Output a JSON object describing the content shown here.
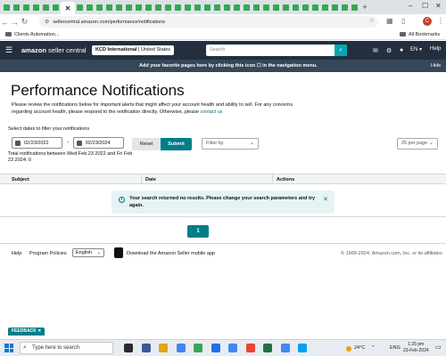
{
  "browser": {
    "url": "sellercentral.amazon.com/performance/notifications",
    "active_tab_glyph": "✕",
    "new_tab": "+",
    "all_bookmarks": "All Bookmarks",
    "bookmark_folder": "Clients Automation...",
    "profile_initial": "C",
    "win_minimize": "–",
    "win_restore": "☐",
    "win_close": "✕",
    "tab_favicon_colors": [
      "#34a853",
      "#34a853",
      "#34a853",
      "#34a853",
      "#34a853",
      "#34a853",
      "#c5402a",
      "#34a853",
      "#34a853",
      "#34a853",
      "#34a853",
      "#34a853",
      "#34a853",
      "#34a853",
      "#34a853",
      "#34a853",
      "#34a853",
      "#34a853",
      "#34a853",
      "#34a853",
      "#34a853",
      "#34a853",
      "#34a853",
      "#34a853",
      "#34a853",
      "#34a853",
      "#34a853",
      "#34a853",
      "#34a853",
      "#34a853",
      "#34a853",
      "#34a853",
      "#34a853",
      "#34a853",
      "#34a853",
      "#34a853"
    ]
  },
  "header": {
    "logo_main": "amazon",
    "logo_sub": " seller central",
    "account_name": "KCD International",
    "account_region": "| United States",
    "search_placeholder": "Search",
    "language": "EN ▾",
    "help": "Help"
  },
  "favorites_bar": {
    "message": "Add your favorite pages here by clicking this icon ☐ in the navigation menu.",
    "hide": "Hide"
  },
  "page": {
    "title": "Performance Notifications",
    "intro": "Please review the notifications below for important alerts that might affect your account health and ability to sell. For any concerns regarding account health, please respond to the notification directly. Otherwise, please ",
    "contact_link": "contact us",
    "filter_label": "Select dates to filter your notifications",
    "date_from": "02/23/2022",
    "date_to": "02/23/2024",
    "date_separator": "-",
    "total": "Total notifications between Wed Feb 23 2022 and Fri Feb 23 2024: 0",
    "reset": "Reset",
    "submit": "Submit",
    "filter_by": "Filter by",
    "per_page": "25 per page"
  },
  "table": {
    "columns": [
      "Subject",
      "Date",
      "Actions"
    ],
    "empty_message": "Your search returned no results. Please change your search parameters and try again."
  },
  "pagination": {
    "current_page": "1"
  },
  "footer": {
    "help": "Help",
    "program_policies": "Program Policies",
    "language": "English",
    "mobile_app": "Download the Amazon Seller mobile app",
    "copyright": "© 1999-2024, Amazon.com, Inc. or its affiliates"
  },
  "feedback": "FEEDBACK ✕",
  "taskbar": {
    "search_placeholder": "Type here to search",
    "weather": "24°C",
    "language": "ENG",
    "time": "1:25 pm",
    "date": "23-Feb-2024",
    "app_colors": [
      "#2b2b2b",
      "#3b5998",
      "#e8a317",
      "#4285f4",
      "#34a853",
      "#1a73e8",
      "#4285f4",
      "#ea4335",
      "#1e7145",
      "#4285f4",
      "#00a4ef"
    ]
  }
}
